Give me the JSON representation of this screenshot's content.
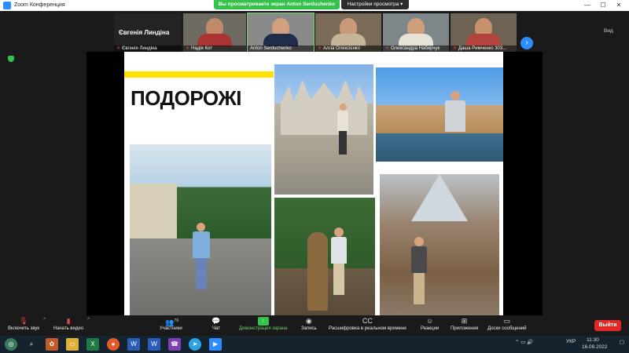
{
  "window": {
    "app_title": "Zoom Конференция",
    "share_status": "Вы просматриваете экран Anton Serduchenko",
    "view_options": "Настройки просмотра ▾",
    "min": "—",
    "max": "☐",
    "close": "✕"
  },
  "strip": {
    "featured_name": "Євгенія Линдіна",
    "tiles": [
      {
        "name": "Євгенія Линдіна",
        "muted": true
      },
      {
        "name": "Надія Кот",
        "muted": true
      },
      {
        "name": "Anton Serduchenko",
        "muted": false
      },
      {
        "name": "Алла Олексієнко",
        "muted": true
      },
      {
        "name": "Олександра Набирчук",
        "muted": true
      },
      {
        "name": "Даша Римченко 303...",
        "muted": true
      }
    ],
    "next_icon": "›",
    "view_label": "Вид"
  },
  "slide": {
    "title": "ПОДОРОЖІ"
  },
  "toolbar": {
    "audio": "Включить звук",
    "video": "Начать видео",
    "participants": "Участники",
    "participants_count": "76",
    "chat": "Чат",
    "share": "Демонстрация экрана",
    "record": "Запись",
    "transcript": "Расшифровка в реальном времени",
    "reactions": "Реакции",
    "apps": "Приложения",
    "whiteboards": "Доски сообщений",
    "leave": "Выйти"
  },
  "taskbar": {
    "lang": "УКР",
    "time": "11:30",
    "date": "16.09.2022"
  },
  "colors": {
    "zoom_blue": "#2d8cff",
    "share_green": "#34c24a",
    "leave_red": "#e02828",
    "accent_yellow": "#ffe000"
  }
}
